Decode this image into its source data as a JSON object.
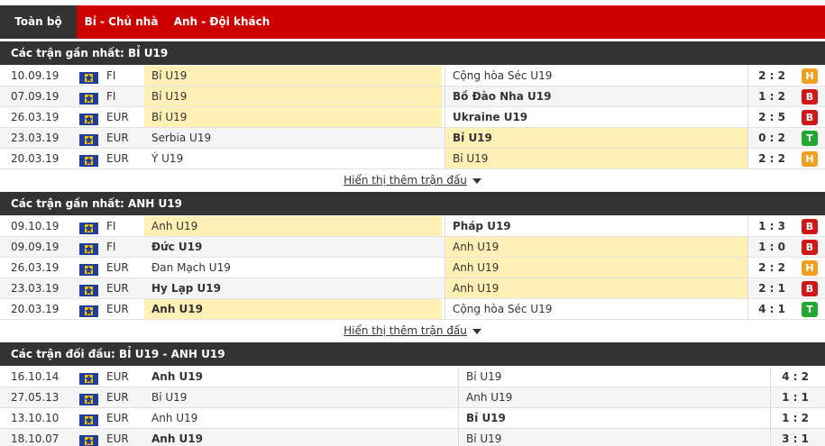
{
  "tabs": [
    "Toàn bộ",
    "Bỉ - Chủ nhà",
    "Anh - Đội khách"
  ],
  "colors": {
    "red": "#cc0000",
    "dark": "#333333",
    "highlight": "#fff1b6",
    "win": "#22a833",
    "draw": "#f0a020",
    "loss": "#d01818"
  },
  "more_label": "Hiển thị thêm trận đấu",
  "sections": [
    {
      "title": "Các trận gần nhất: BỈ U19",
      "rows": [
        {
          "date": "10.09.19",
          "league": "FI",
          "home": "Bỉ U19",
          "away": "Cộng hòa Séc U19",
          "score": "2 : 2",
          "result": "H",
          "hl": "home",
          "bold": ""
        },
        {
          "date": "07.09.19",
          "league": "FI",
          "home": "Bỉ U19",
          "away": "Bồ Đào Nha U19",
          "score": "1 : 2",
          "result": "B",
          "hl": "home",
          "bold": "away"
        },
        {
          "date": "26.03.19",
          "league": "EUR",
          "home": "Bỉ U19",
          "away": "Ukraine U19",
          "score": "2 : 5",
          "result": "B",
          "hl": "home",
          "bold": "away"
        },
        {
          "date": "23.03.19",
          "league": "EUR",
          "home": "Serbia U19",
          "away": "Bỉ U19",
          "score": "0 : 2",
          "result": "T",
          "hl": "away",
          "bold": "away"
        },
        {
          "date": "20.03.19",
          "league": "EUR",
          "home": "Ý U19",
          "away": "Bỉ U19",
          "score": "2 : 2",
          "result": "H",
          "hl": "away",
          "bold": ""
        }
      ]
    },
    {
      "title": "Các trận gần nhất: ANH U19",
      "rows": [
        {
          "date": "09.10.19",
          "league": "FI",
          "home": "Anh U19",
          "away": "Pháp U19",
          "score": "1 : 3",
          "result": "B",
          "hl": "home",
          "bold": "away"
        },
        {
          "date": "09.09.19",
          "league": "FI",
          "home": "Đức U19",
          "away": "Anh U19",
          "score": "1 : 0",
          "result": "B",
          "hl": "away",
          "bold": "home"
        },
        {
          "date": "26.03.19",
          "league": "EUR",
          "home": "Đan Mạch U19",
          "away": "Anh U19",
          "score": "2 : 2",
          "result": "H",
          "hl": "away",
          "bold": ""
        },
        {
          "date": "23.03.19",
          "league": "EUR",
          "home": "Hy Lạp U19",
          "away": "Anh U19",
          "score": "2 : 1",
          "result": "B",
          "hl": "away",
          "bold": "home"
        },
        {
          "date": "20.03.19",
          "league": "EUR",
          "home": "Anh U19",
          "away": "Cộng hòa Séc U19",
          "score": "4 : 1",
          "result": "T",
          "hl": "home",
          "bold": "home"
        }
      ]
    }
  ],
  "h2h": {
    "title": "Các trận đối đầu: BỈ U19 - ANH U19",
    "rows": [
      {
        "date": "16.10.14",
        "league": "EUR",
        "home": "Anh U19",
        "away": "Bỉ U19",
        "score": "4 : 2",
        "bold": "home"
      },
      {
        "date": "27.05.13",
        "league": "EUR",
        "home": "Bỉ U19",
        "away": "Anh U19",
        "score": "1 : 1",
        "bold": ""
      },
      {
        "date": "13.10.10",
        "league": "EUR",
        "home": "Anh U19",
        "away": "Bỉ U19",
        "score": "1 : 2",
        "bold": "away"
      },
      {
        "date": "18.10.07",
        "league": "EUR",
        "home": "Anh U19",
        "away": "Bỉ U19",
        "score": "3 : 1",
        "bold": "home"
      }
    ]
  }
}
